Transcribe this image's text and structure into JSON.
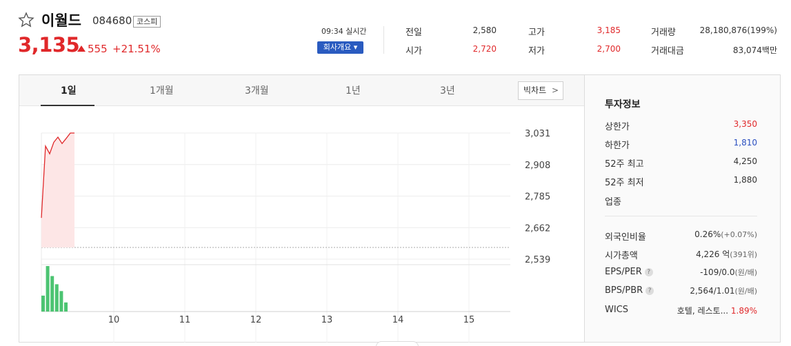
{
  "stock": {
    "name": "이월드",
    "code": "084680",
    "market": "코스피",
    "price": "3,135",
    "change": "555",
    "change_pct": "+21.51%",
    "time_label": "09:34 실시간",
    "company_btn": "회사개요 ▾"
  },
  "quotes": [
    {
      "label": "전일",
      "value": "2,580"
    },
    {
      "label": "고가",
      "value": "3,185"
    },
    {
      "label": "거래량",
      "value": "28,180,876(199%)"
    },
    {
      "label": "시가",
      "value": "2,720"
    },
    {
      "label": "저가",
      "value": "2,700"
    },
    {
      "label": "거래대금",
      "value": "83,074백만"
    }
  ],
  "tabs": [
    "1일",
    "1개월",
    "3개월",
    "1년",
    "3년"
  ],
  "big_chart": "빅차트",
  "chart_data": {
    "type": "line",
    "price_axis": [
      3031,
      2908,
      2785,
      2662,
      2539
    ],
    "x_labels": [
      "10",
      "11",
      "12",
      "13",
      "14",
      "15"
    ],
    "prices": [
      2700,
      2980,
      2950,
      2995,
      3015,
      2990,
      3010,
      3031,
      3031
    ],
    "volume": [
      0.35,
      1.0,
      0.78,
      0.6,
      0.45,
      0.2
    ],
    "baseline": 2580,
    "colors": {
      "line": "#e0282a",
      "fill": "#fde6e6",
      "volume": "#4cc472"
    }
  },
  "info": {
    "title": "투자정보",
    "rows": [
      {
        "label": "상한가",
        "value": "3,350"
      },
      {
        "label": "하한가",
        "value": "1,810"
      },
      {
        "label": "52주 최고",
        "value": "4,250"
      },
      {
        "label": "52주 최저",
        "value": "1,880"
      },
      {
        "label": "업종",
        "value": ""
      }
    ],
    "rows2": [
      {
        "label": "외국인비율",
        "value": "0.26%",
        "sub": "(+0.07%)"
      },
      {
        "label": "시가총액",
        "value": "4,226 억",
        "sub": "(391위)"
      },
      {
        "label": "EPS/PER",
        "value": "-109/0.0",
        "sub": "(원/배)"
      },
      {
        "label": "BPS/PBR",
        "value": "2,564/1.01",
        "sub": "(원/배)"
      },
      {
        "label": "WICS",
        "value": "호텔, 레스토...",
        "sub": "1.89%"
      }
    ]
  }
}
